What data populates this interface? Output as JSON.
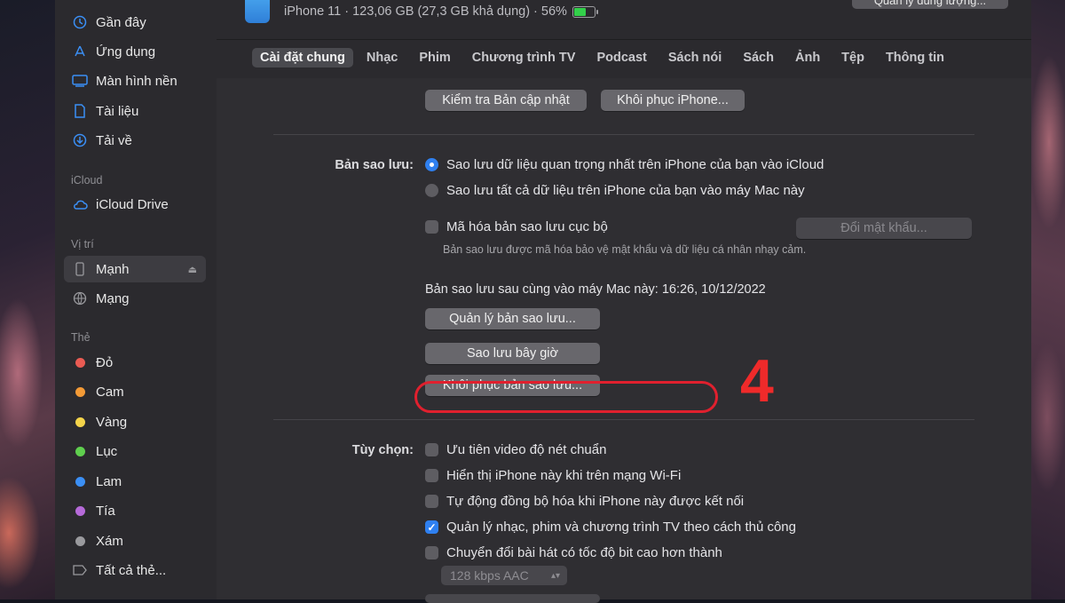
{
  "sidebar": {
    "favorites": [
      {
        "label": "Gần đây",
        "icon": "clock-icon"
      },
      {
        "label": "Ứng dụng",
        "icon": "apps-icon"
      },
      {
        "label": "Màn hình nền",
        "icon": "desktop-icon"
      },
      {
        "label": "Tài liệu",
        "icon": "document-icon"
      },
      {
        "label": "Tải về",
        "icon": "download-icon"
      }
    ],
    "icloud_header": "iCloud",
    "icloud_drive": "iCloud Drive",
    "locations_header": "Vị trí",
    "locations": [
      {
        "label": "Mạnh",
        "icon": "iphone-icon",
        "active": true
      },
      {
        "label": "Mạng",
        "icon": "network-icon"
      }
    ],
    "tags_header": "Thẻ",
    "tags": [
      {
        "label": "Đỏ",
        "color": "#ea5b53"
      },
      {
        "label": "Cam",
        "color": "#f39a36"
      },
      {
        "label": "Vàng",
        "color": "#f5d44a"
      },
      {
        "label": "Lục",
        "color": "#5fcf4e"
      },
      {
        "label": "Lam",
        "color": "#3b8ff5"
      },
      {
        "label": "Tía",
        "color": "#b66ad9"
      },
      {
        "label": "Xám",
        "color": "#9a9a9e"
      }
    ],
    "all_tags": "Tất cả thẻ..."
  },
  "header": {
    "device_info": "iPhone 11 · 123,06 GB (27,3 GB khả dụng) · 56%",
    "battery_level": 0.56,
    "manage_storage": "Quản lý dung lượng..."
  },
  "tabs": [
    {
      "label": "Cài đặt chung",
      "active": true
    },
    {
      "label": "Nhạc"
    },
    {
      "label": "Phim"
    },
    {
      "label": "Chương trình TV"
    },
    {
      "label": "Podcast"
    },
    {
      "label": "Sách nói"
    },
    {
      "label": "Sách"
    },
    {
      "label": "Ảnh"
    },
    {
      "label": "Tệp"
    },
    {
      "label": "Thông tin"
    }
  ],
  "software": {
    "check_update": "Kiểm tra Bản cập nhật",
    "restore_iphone": "Khôi phục iPhone..."
  },
  "backup": {
    "label": "Bản sao lưu:",
    "option_icloud": "Sao lưu dữ liệu quan trọng nhất trên iPhone của bạn vào iCloud",
    "option_mac": "Sao lưu tất cả dữ liệu trên iPhone của bạn vào máy Mac này",
    "encrypt": "Mã hóa bản sao lưu cục bộ",
    "change_password": "Đổi mật khẩu...",
    "encrypt_note": "Bản sao lưu được mã hóa bảo vệ mật khẩu và dữ liệu cá nhân nhạy cảm.",
    "last_backup": "Bản sao lưu sau cùng vào máy Mac này: 16:26, 10/12/2022",
    "manage_backups": "Quản lý bản sao lưu...",
    "backup_now": "Sao lưu bây giờ",
    "restore_backup": "Khôi phục bản sao lưu..."
  },
  "options": {
    "label": "Tùy chọn:",
    "items": [
      {
        "label": "Ưu tiên video độ nét chuẩn",
        "checked": false
      },
      {
        "label": "Hiển thị iPhone này khi trên mạng Wi-Fi",
        "checked": false
      },
      {
        "label": "Tự động đồng bộ hóa khi iPhone này được kết nối",
        "checked": false
      },
      {
        "label": "Quản lý nhạc, phim và chương trình TV theo cách thủ công",
        "checked": true
      },
      {
        "label": "Chuyển đổi bài hát có tốc độ bit cao hơn thành",
        "checked": false
      }
    ],
    "bitrate": "128 kbps AAC"
  },
  "annotation": {
    "step_number": "4",
    "color": "#e0202e"
  }
}
